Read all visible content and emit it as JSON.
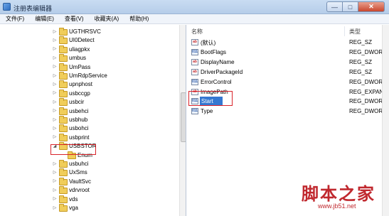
{
  "window": {
    "title": "注册表编辑器"
  },
  "window_controls": [
    "—",
    "□",
    "✕"
  ],
  "menu": [
    "文件(F)",
    "编辑(E)",
    "查看(V)",
    "收藏夹(A)",
    "帮助(H)"
  ],
  "tree": {
    "items": [
      {
        "label": "UGTHRSVC"
      },
      {
        "label": "UI0Detect"
      },
      {
        "label": "uliagpkx"
      },
      {
        "label": "umbus"
      },
      {
        "label": "UmPass"
      },
      {
        "label": "UmRdpService"
      },
      {
        "label": "upnphost"
      },
      {
        "label": "usbccgp"
      },
      {
        "label": "usbcir"
      },
      {
        "label": "usbehci"
      },
      {
        "label": "usbhub"
      },
      {
        "label": "usbohci"
      },
      {
        "label": "usbprint"
      },
      {
        "label": "USBSTOR",
        "expanded": true,
        "highlighted": true
      },
      {
        "label": "Enum",
        "child": true
      },
      {
        "label": "usbuhci"
      },
      {
        "label": "UxSms"
      },
      {
        "label": "VaultSvc"
      },
      {
        "label": "vdrvroot"
      },
      {
        "label": "vds"
      },
      {
        "label": "vga"
      }
    ]
  },
  "list": {
    "columns": {
      "name": "名称",
      "type": "类型"
    },
    "rows": [
      {
        "name": "(默认)",
        "type": "REG_SZ",
        "icon": "string-value-icon"
      },
      {
        "name": "BootFlags",
        "type": "REG_DWORD",
        "icon": "binary-value-icon"
      },
      {
        "name": "DisplayName",
        "type": "REG_SZ",
        "icon": "string-value-icon"
      },
      {
        "name": "DriverPackageId",
        "type": "REG_SZ",
        "icon": "string-value-icon"
      },
      {
        "name": "ErrorControl",
        "type": "REG_DWORD",
        "icon": "binary-value-icon"
      },
      {
        "name": "ImagePath",
        "type": "REG_EXPAND_S",
        "icon": "string-value-icon"
      },
      {
        "name": "Start",
        "type": "REG_DWORD",
        "icon": "binary-value-icon",
        "selected": true,
        "highlighted": true
      },
      {
        "name": "Type",
        "type": "REG_DWORD",
        "icon": "binary-value-icon"
      }
    ]
  },
  "watermark": {
    "text": "脚本之家",
    "url": "www.jb51.net"
  },
  "colors": {
    "highlight": "#d9232a",
    "selection": "#3578d1",
    "watermark": "#c0282e"
  }
}
